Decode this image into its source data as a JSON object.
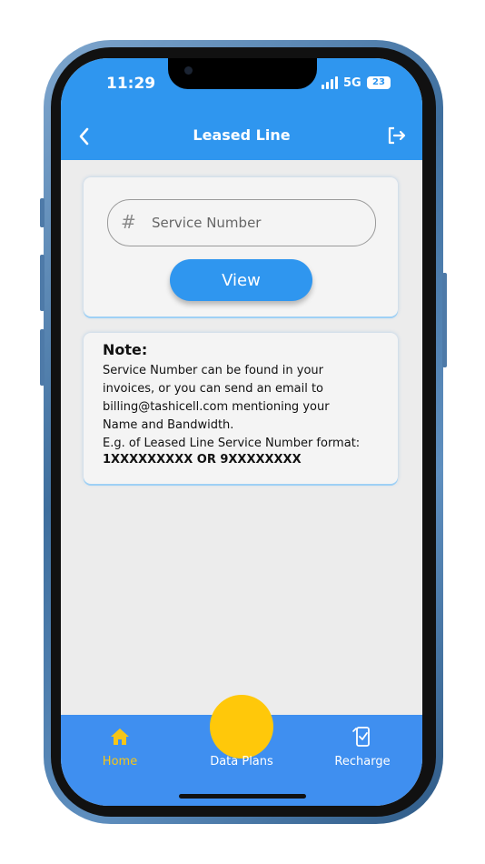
{
  "status_bar": {
    "time": "11:29",
    "network": "5G",
    "battery": "23"
  },
  "header": {
    "title": "Leased Line",
    "back_icon": "chevron-left-icon",
    "logout_icon": "logout-icon"
  },
  "search": {
    "placeholder": "Service Number",
    "icon": "hash-icon",
    "button_label": "View"
  },
  "note": {
    "title": "Note:",
    "lines": [
      "Service Number can be found in your",
      "invoices, or you can send an email to",
      "billing@tashicell.com mentioning your",
      "Name and Bandwidth.",
      "E.g. of Leased Line Service Number format:"
    ],
    "format": "1XXXXXXXXX OR 9XXXXXXXX"
  },
  "bottom_nav": {
    "home": {
      "label": "Home",
      "icon": "home-icon"
    },
    "data_plans": {
      "label": "Data Plans"
    },
    "recharge": {
      "label": "Recharge",
      "icon": "recharge-icon"
    }
  },
  "colors": {
    "primary": "#2f96ef",
    "nav": "#3f8ff0",
    "accent": "#ffc80a",
    "active": "#f5c518"
  }
}
